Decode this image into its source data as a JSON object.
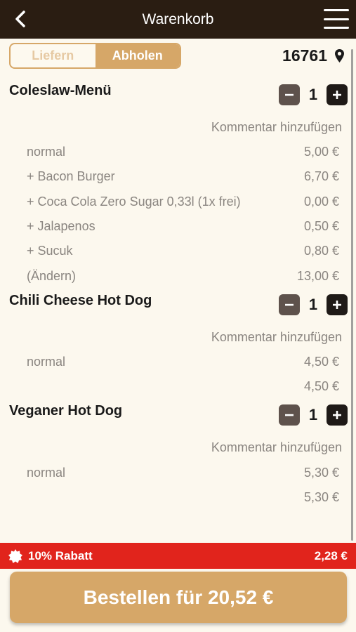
{
  "header": {
    "title": "Warenkorb"
  },
  "mode_toggle": {
    "options": [
      {
        "label": "Liefern",
        "active": false
      },
      {
        "label": "Abholen",
        "active": true
      }
    ]
  },
  "location": {
    "zip": "16761"
  },
  "cart": {
    "items": [
      {
        "name": "Coleslaw-Menü",
        "quantity": "1",
        "comment_label": "Kommentar hinzufügen",
        "lines": [
          {
            "label": "normal",
            "price": "5,00 €"
          },
          {
            "label": "+ Bacon Burger",
            "price": "6,70 €"
          },
          {
            "label": "+ Coca Cola Zero Sugar 0,33l (1x frei)",
            "price": "0,00 €"
          },
          {
            "label": "+ Jalapenos",
            "price": "0,50 €"
          },
          {
            "label": "+ Sucuk",
            "price": "0,80 €"
          },
          {
            "label": "(Ändern)",
            "price": "13,00 €"
          }
        ]
      },
      {
        "name": "Chili Cheese Hot Dog",
        "quantity": "1",
        "comment_label": "Kommentar hinzufügen",
        "lines": [
          {
            "label": "normal",
            "price": "4,50 €"
          },
          {
            "label": "",
            "price": "4,50 €"
          }
        ]
      },
      {
        "name": "Veganer Hot Dog",
        "quantity": "1",
        "comment_label": "Kommentar hinzufügen",
        "lines": [
          {
            "label": "normal",
            "price": "5,30 €"
          },
          {
            "label": "",
            "price": "5,30 €"
          }
        ]
      }
    ]
  },
  "discount": {
    "label": "10% Rabatt",
    "amount": "2,28 €"
  },
  "order_button": {
    "label": "Bestellen für 20,52 €"
  },
  "colors": {
    "header_bg": "#2a1d12",
    "accent": "#d6a768",
    "discount_bg": "#e1241c",
    "page_bg": "#fcf8ee"
  }
}
